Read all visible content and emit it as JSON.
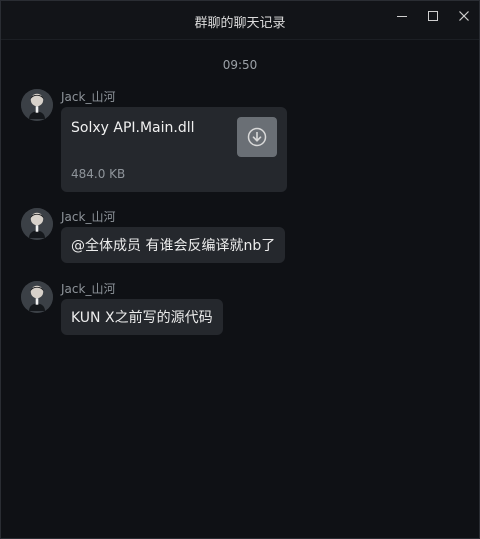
{
  "window": {
    "title": "群聊的聊天记录"
  },
  "controls": {
    "minimize_icon": "minimize-icon",
    "maximize_icon": "maximize-icon",
    "close_icon": "close-icon"
  },
  "chat": {
    "time": "09:50",
    "messages": [
      {
        "sender": "Jack_山河",
        "type": "file",
        "file_name": "Solxy API.Main.dll",
        "file_size": "484.0 KB",
        "download_icon": "download-icon"
      },
      {
        "sender": "Jack_山河",
        "type": "text",
        "text": "@全体成员 有谁会反编译就nb了"
      },
      {
        "sender": "Jack_山河",
        "type": "text",
        "text": "KUN X之前写的源代码"
      }
    ]
  },
  "colors": {
    "background": "#0f1115",
    "bubble": "#25282d",
    "title_bar": "#121418",
    "download_button": "#6a6f75",
    "secondary_text": "#8e949a"
  }
}
